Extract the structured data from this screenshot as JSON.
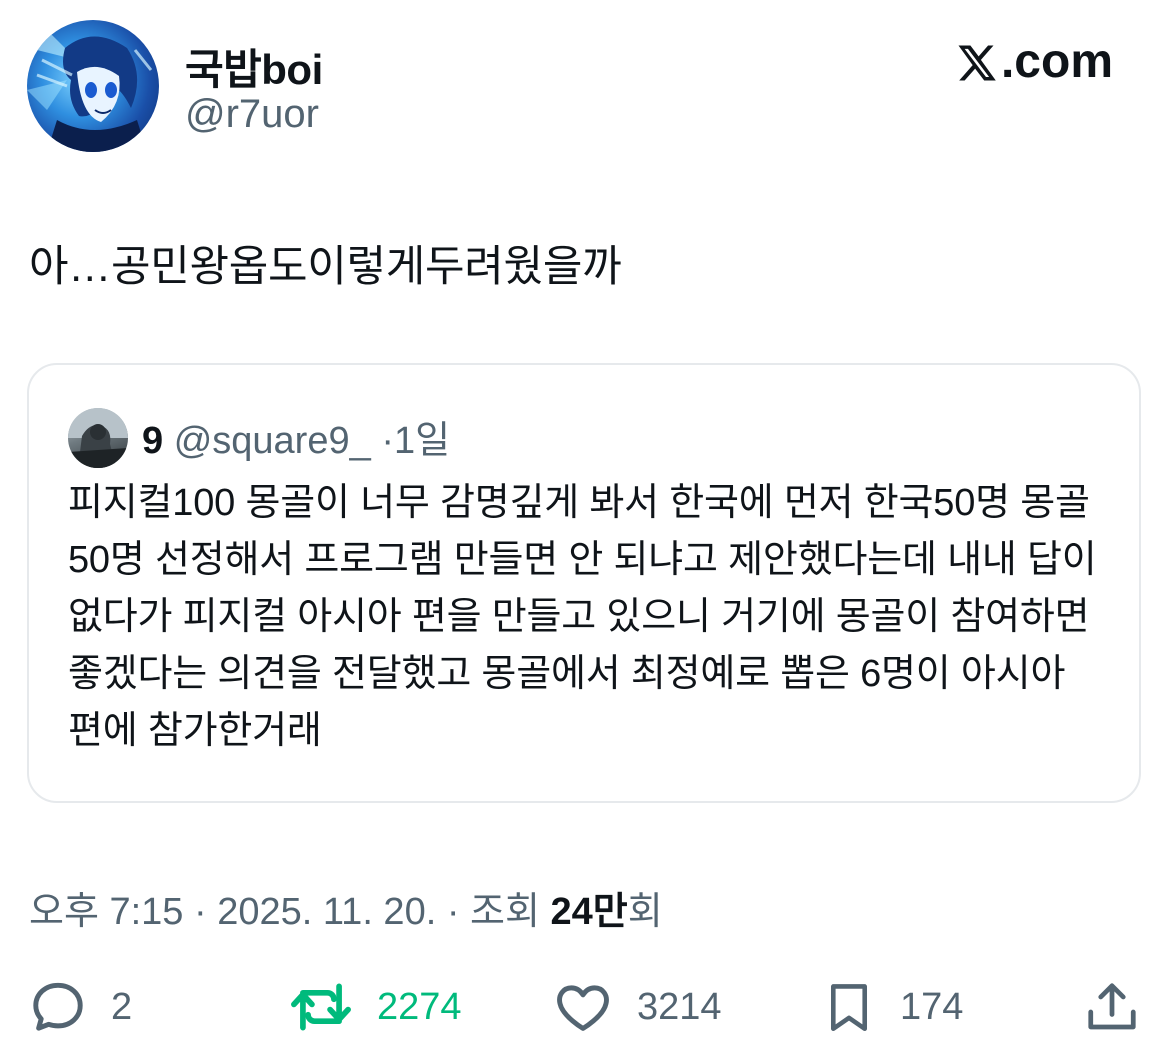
{
  "author": {
    "display_name": "국밥boi",
    "handle": "@r7uor"
  },
  "brand": {
    "label": ".com"
  },
  "tweet": {
    "text": "아…공민왕옵도이렇게두려웠을까"
  },
  "quote": {
    "name": "9",
    "handle": "@square9_",
    "separator": "·",
    "time": "1일",
    "body": "피지컬100 몽골이 너무 감명깊게 봐서 한국에 먼저 한국50명 몽골50명 선정해서 프로그램 만들면 안 되냐고 제안했다는데 내내 답이 없다가 피지컬 아시아 편을 만들고 있으니 거기에 몽골이 참여하면 좋겠다는 의견을 전달했고 몽골에서 최정예로 뽑은 6명이 아시아 편에 참가한거래"
  },
  "meta": {
    "time": "오후 7:15",
    "sep1": "·",
    "date": "2025. 11. 20.",
    "sep2": "·",
    "views_prefix": "조회",
    "views_count": "24만",
    "views_suffix": "회"
  },
  "actions": {
    "replies": "2",
    "retweets": "2274",
    "likes": "3214",
    "bookmarks": "174"
  },
  "colors": {
    "text": "#0f1419",
    "secondary": "#536471",
    "retweet_green": "#00ba7c",
    "border": "#e6e9ec"
  },
  "icons": [
    "reply-icon",
    "retweet-icon",
    "like-icon",
    "bookmark-icon",
    "share-icon",
    "x-logo-icon"
  ]
}
